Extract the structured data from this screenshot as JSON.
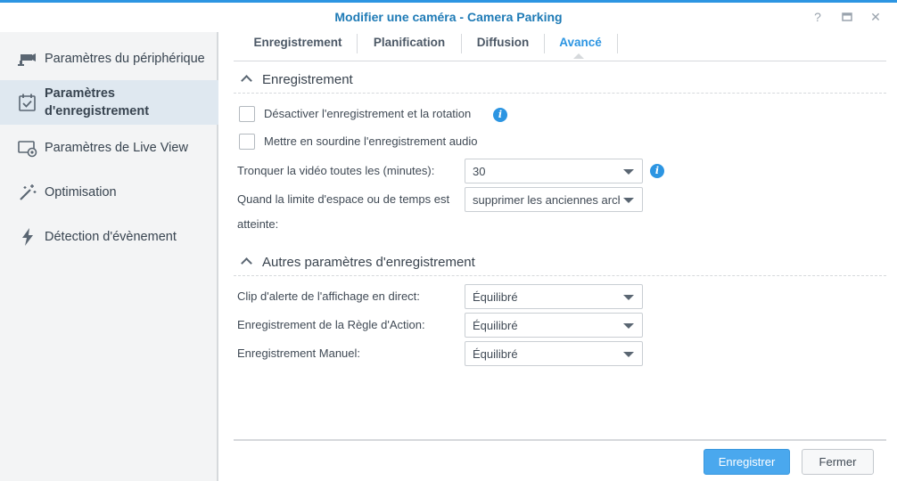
{
  "window": {
    "title": "Modifier une caméra - Camera Parking",
    "help_glyph": "?",
    "minimize_glyph": "▭",
    "close_glyph": "✕"
  },
  "sidebar": {
    "items": [
      {
        "label": "Paramètres du périphérique",
        "icon": "camera-icon"
      },
      {
        "label": "Paramètres d'enregistrement",
        "icon": "calendar-check-icon",
        "active": true
      },
      {
        "label": "Paramètres de Live View",
        "icon": "monitor-icon"
      },
      {
        "label": "Optimisation",
        "icon": "magic-wand-icon"
      },
      {
        "label": "Détection d'évènement",
        "icon": "lightning-icon"
      }
    ]
  },
  "tabs": [
    {
      "label": "Enregistrement"
    },
    {
      "label": "Planification"
    },
    {
      "label": "Diffusion"
    },
    {
      "label": "Avancé",
      "active": true
    }
  ],
  "sections": {
    "recording": {
      "title": "Enregistrement",
      "disable_rotation_label": "Désactiver l'enregistrement et la rotation",
      "mute_audio_label": "Mettre en sourdine l'enregistrement audio",
      "truncate_label": "Tronquer la vidéo toutes les (minutes):",
      "truncate_value": "30",
      "limit_label_line1": "Quand la limite d'espace ou de temps est",
      "limit_label_line2": "atteinte:",
      "limit_value": "supprimer les anciennes archives"
    },
    "other": {
      "title": "Autres paramètres d'enregistrement",
      "live_alert_label": "Clip d'alerte de l'affichage en direct:",
      "live_alert_value": "Équilibré",
      "action_rule_label": "Enregistrement de la Règle d'Action:",
      "action_rule_value": "Équilibré",
      "manual_label": "Enregistrement Manuel:",
      "manual_value": "Équilibré"
    }
  },
  "info_glyph": "i",
  "footer": {
    "save_label": "Enregistrer",
    "close_label": "Fermer"
  },
  "colors": {
    "accent": "#2c95e2",
    "title": "#1f7bb6",
    "sidebar_bg": "#f3f4f5",
    "sidebar_active": "#dfe8f0"
  }
}
